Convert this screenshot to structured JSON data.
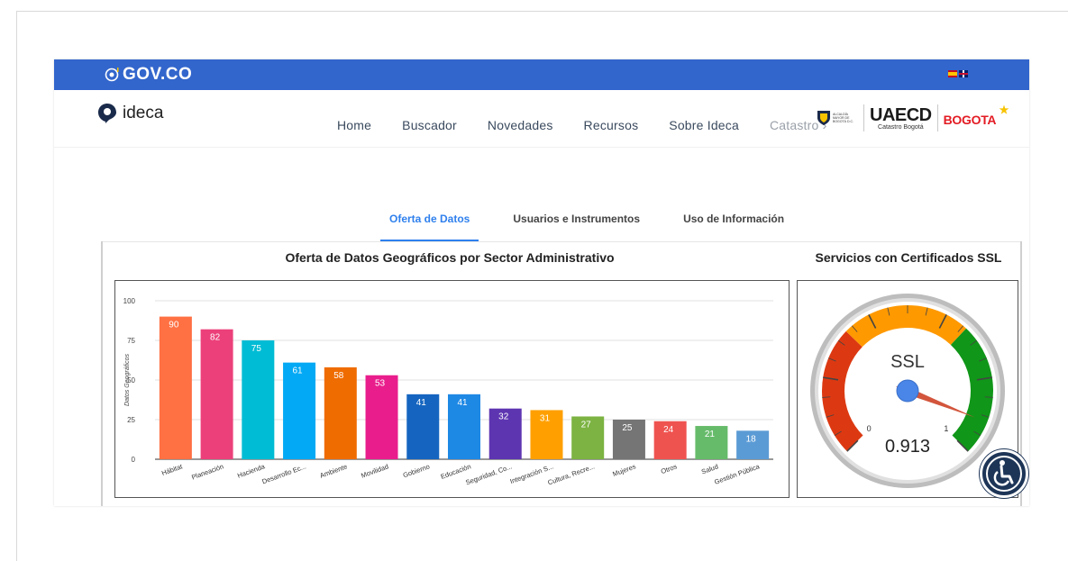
{
  "gov_bar": {
    "logo_text": "GOV.CO",
    "languages": [
      "es",
      "en"
    ]
  },
  "brand": {
    "name": "ideca"
  },
  "nav": {
    "items": [
      "Home",
      "Buscador",
      "Novedades",
      "Recursos",
      "Sobre Ideca"
    ],
    "more_label": "Catastro ›"
  },
  "partner_logos": {
    "alcaldia": "ALCALDÍA MAYOR DE BOGOTÁ D.C.",
    "uaecd_title": "UAECD",
    "uaecd_sub": "Catastro Bogotá",
    "bogota": "BOGOTA"
  },
  "tabs": [
    {
      "label": "Oferta de Datos",
      "active": true
    },
    {
      "label": "Usuarios e Instrumentos",
      "active": false
    },
    {
      "label": "Uso de Información",
      "active": false
    }
  ],
  "bar_panel": {
    "title": "Oferta de Datos Geográficos por Sector Administrativo"
  },
  "gauge_panel": {
    "title": "Servicios con Certificados SSL"
  },
  "chart_data": [
    {
      "type": "bar",
      "title": "Oferta de Datos Geográficos por Sector Administrativo",
      "ylabel": "Datos Geográficos",
      "xlabel": "",
      "ylim": [
        0,
        100
      ],
      "yticks": [
        0,
        25,
        50,
        75,
        100
      ],
      "grid": true,
      "categories": [
        "Hábitat",
        "Planeación",
        "Hacienda",
        "Desarrollo Ec...",
        "Ambiente",
        "Movilidad",
        "Gobierno",
        "Educación",
        "Seguridad, Co...",
        "Integración S...",
        "Cultura, Recre...",
        "Mujeres",
        "Otros",
        "Salud",
        "Gestión Pública"
      ],
      "values": [
        90,
        82,
        75,
        61,
        58,
        53,
        41,
        41,
        32,
        31,
        27,
        25,
        24,
        21,
        18
      ],
      "colors": [
        "#ff7043",
        "#ec407a",
        "#00bcd4",
        "#03a9f4",
        "#ef6c00",
        "#e91e8c",
        "#1565c0",
        "#1e88e5",
        "#5e35b1",
        "#ffa000",
        "#7cb342",
        "#757575",
        "#ef5350",
        "#66bb6a",
        "#5b9bd5"
      ]
    },
    {
      "type": "gauge",
      "title": "Servicios con Certificados SSL",
      "label": "SSL",
      "value": 0.913,
      "value_text": "0.913",
      "min": 0,
      "max": 1,
      "min_label": "0",
      "max_label": "1",
      "bands": [
        {
          "from": 0.0,
          "to": 0.33,
          "color": "#dc3912"
        },
        {
          "from": 0.33,
          "to": 0.66,
          "color": "#ff9900"
        },
        {
          "from": 0.66,
          "to": 1.0,
          "color": "#109618"
        }
      ]
    }
  ],
  "colors": {
    "gov_blue": "#3366cc",
    "accent_blue": "#2f80ed",
    "accessibility": "#1d3557"
  }
}
